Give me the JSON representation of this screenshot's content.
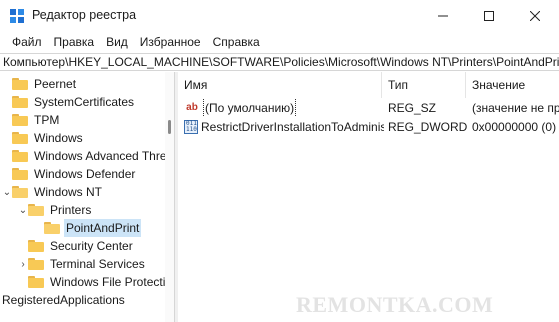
{
  "window": {
    "title": "Редактор реестра",
    "controls": {
      "minimize_icon": "minimize-icon",
      "maximize_icon": "maximize-icon",
      "close_icon": "close-icon"
    }
  },
  "menu": [
    "Файл",
    "Правка",
    "Вид",
    "Избранное",
    "Справка"
  ],
  "address": "Компьютер\\HKEY_LOCAL_MACHINE\\SOFTWARE\\Policies\\Microsoft\\Windows NT\\Printers\\PointAndPrint",
  "tree": [
    {
      "label": "Peernet",
      "expander": "",
      "depth": 0,
      "open": false
    },
    {
      "label": "SystemCertificates",
      "expander": "",
      "depth": 0,
      "open": false
    },
    {
      "label": "TPM",
      "expander": "",
      "depth": 0,
      "open": false
    },
    {
      "label": "Windows",
      "expander": "",
      "depth": 0,
      "open": false
    },
    {
      "label": "Windows Advanced Threat",
      "expander": "",
      "depth": 0,
      "open": false
    },
    {
      "label": "Windows Defender",
      "expander": "",
      "depth": 0,
      "open": false
    },
    {
      "label": "Windows NT",
      "expander": "expanded",
      "depth": 0,
      "open": true
    },
    {
      "label": "Printers",
      "expander": "expanded",
      "depth": 1,
      "open": true
    },
    {
      "label": "PointAndPrint",
      "expander": "",
      "depth": 2,
      "open": true,
      "selected": true
    },
    {
      "label": "Security Center",
      "expander": "",
      "depth": 1,
      "open": false
    },
    {
      "label": "Terminal Services",
      "expander": "collapsed",
      "depth": 1,
      "open": false
    },
    {
      "label": "Windows File Protection",
      "expander": "",
      "depth": 1,
      "open": false
    },
    {
      "label": "RegisteredApplications",
      "expander": "",
      "depth": -1,
      "open": false,
      "no_icon": true
    }
  ],
  "columns": {
    "name": "Имя",
    "type": "Тип",
    "value": "Значение"
  },
  "values": [
    {
      "icon": "string-value-icon",
      "icon_glyph": "ab",
      "name": "(По умолчанию)",
      "type": "REG_SZ",
      "value": "(значение не присвоено)",
      "focused": true
    },
    {
      "icon": "binary-value-icon",
      "icon_glyph": "",
      "name": "RestrictDriverInstallationToAdministrators",
      "type": "REG_DWORD",
      "value": "0x00000000 (0)",
      "focused": false
    }
  ],
  "watermark": "REMONTKA.COM",
  "colors": {
    "selection": "#cce4f7",
    "folder": "#f8c955",
    "app_icon": "#1f6fd1"
  }
}
